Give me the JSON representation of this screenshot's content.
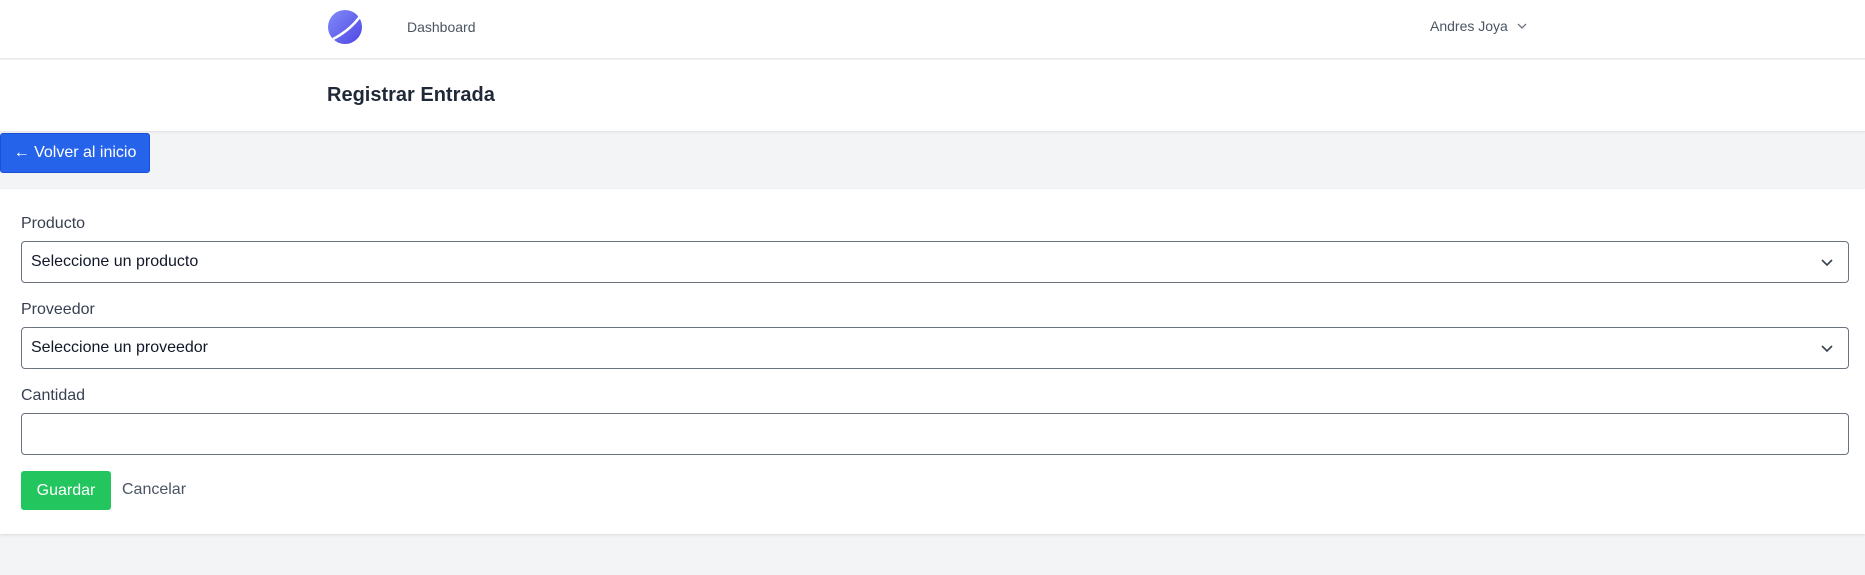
{
  "nav": {
    "dashboard_label": "Dashboard",
    "user_name": "Andres Joya"
  },
  "header": {
    "title": "Registrar Entrada"
  },
  "back_button": {
    "label": "← Volver al inicio"
  },
  "form": {
    "producto": {
      "label": "Producto",
      "selected": "Seleccione un producto"
    },
    "proveedor": {
      "label": "Proveedor",
      "selected": "Seleccione un proveedor"
    },
    "cantidad": {
      "label": "Cantidad",
      "value": ""
    },
    "save_label": "Guardar",
    "cancel_label": "Cancelar"
  },
  "colors": {
    "accent_blue": "#2563eb",
    "success_green": "#22c55e",
    "logo_purple": "#6366f1"
  },
  "icons": {
    "logo": "app-logo-icon",
    "user_chevron": "chevron-down-icon",
    "select_chevron": "chevron-down-icon"
  }
}
